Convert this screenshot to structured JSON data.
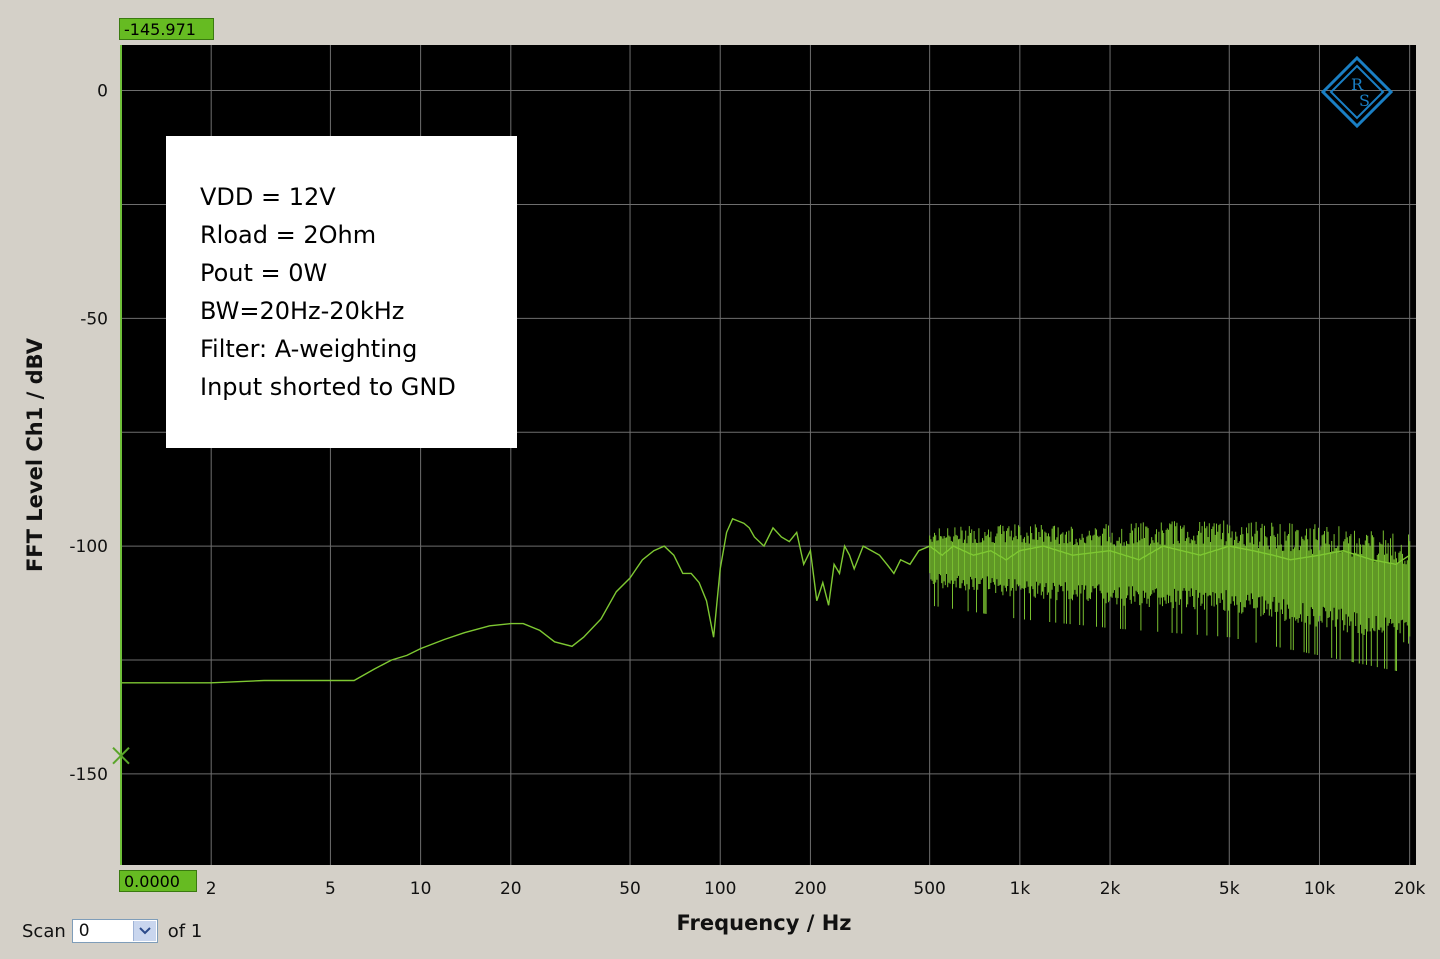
{
  "chart_data": {
    "type": "line",
    "xlabel": "Frequency / Hz",
    "ylabel": "FFT Level Ch1 / dBV",
    "x_scale": "log",
    "xlim": [
      1,
      21000
    ],
    "ylim": [
      -170,
      10
    ],
    "grid": true,
    "x_ticks": [
      {
        "value": 2,
        "label": "2"
      },
      {
        "value": 5,
        "label": "5"
      },
      {
        "value": 10,
        "label": "10"
      },
      {
        "value": 20,
        "label": "20"
      },
      {
        "value": 50,
        "label": "50"
      },
      {
        "value": 100,
        "label": "100"
      },
      {
        "value": 200,
        "label": "200"
      },
      {
        "value": 500,
        "label": "500"
      },
      {
        "value": 1000,
        "label": "1k"
      },
      {
        "value": 2000,
        "label": "2k"
      },
      {
        "value": 5000,
        "label": "5k"
      },
      {
        "value": 10000,
        "label": "10k"
      },
      {
        "value": 20000,
        "label": "20k"
      }
    ],
    "y_ticks": [
      {
        "value": 0,
        "label": "0"
      },
      {
        "value": -50,
        "label": "-50"
      },
      {
        "value": -100,
        "label": "-100"
      },
      {
        "value": -150,
        "label": "-150"
      }
    ],
    "series": [
      {
        "color": "#7ec832",
        "x": [
          1,
          2,
          3,
          4,
          5,
          6,
          7,
          8,
          9,
          10,
          12,
          14,
          17,
          20,
          22,
          25,
          28,
          32,
          35,
          40,
          45,
          50,
          55,
          60,
          65,
          70,
          75,
          80,
          85,
          90,
          95,
          100,
          105,
          110,
          115,
          120,
          125,
          130,
          140,
          150,
          160,
          170,
          180,
          190,
          200,
          210,
          220,
          230,
          240,
          250,
          260,
          270,
          280,
          300,
          320,
          340,
          360,
          380,
          400,
          430,
          460,
          500,
          550,
          600,
          700,
          800,
          900,
          1000,
          1200,
          1500,
          2000,
          2500,
          3000,
          4000,
          5000,
          6000,
          7000,
          8000,
          10000,
          12000,
          15000,
          18000,
          20000
        ],
        "y": [
          -130,
          -130,
          -129.5,
          -129.5,
          -129.5,
          -129.5,
          -127,
          -125,
          -124,
          -122.5,
          -120.5,
          -119,
          -117.5,
          -117,
          -117,
          -118.5,
          -121,
          -122,
          -120,
          -116,
          -110,
          -107,
          -103,
          -101,
          -100,
          -102,
          -106,
          -106,
          -108,
          -112,
          -120,
          -105,
          -97,
          -94,
          -94.5,
          -95,
          -96,
          -98,
          -100,
          -96,
          -98,
          -99,
          -97,
          -104,
          -101,
          -112,
          -108,
          -113,
          -104,
          -106,
          -100,
          -102,
          -105,
          -100,
          -101,
          -102,
          -104,
          -106,
          -103,
          -104,
          -101,
          -100,
          -102,
          -100,
          -102,
          -101,
          -103,
          -101,
          -100,
          -102,
          -101,
          -103,
          -100,
          -102,
          -100,
          -101,
          -102,
          -103,
          -102,
          -101,
          -103,
          -104,
          -102
        ],
        "noise_band": {
          "x": [
            500,
            1000,
            2000,
            5000,
            10000,
            20000
          ],
          "upper": [
            -96,
            -95,
            -95,
            -94,
            -95,
            -97
          ],
          "lower": [
            -113,
            -116,
            -118,
            -120,
            -124,
            -128
          ]
        }
      }
    ]
  },
  "markers": {
    "top_left_value": "-145.971",
    "bottom_left_value": "0.0000",
    "cursor_y_value": -146
  },
  "note_lines": [
    "VDD = 12V",
    "Rload = 2Ohm",
    "Pout = 0W",
    "BW=20Hz-20kHz",
    "Filter: A-weighting",
    "Input shorted to GND"
  ],
  "scan": {
    "label": "Scan",
    "value": "0",
    "of_label": "of 1"
  },
  "colors": {
    "plot_background": "#000000",
    "grid": "#6e6e6e",
    "trace": "#7ec832",
    "logo": "#1a7fc4"
  }
}
